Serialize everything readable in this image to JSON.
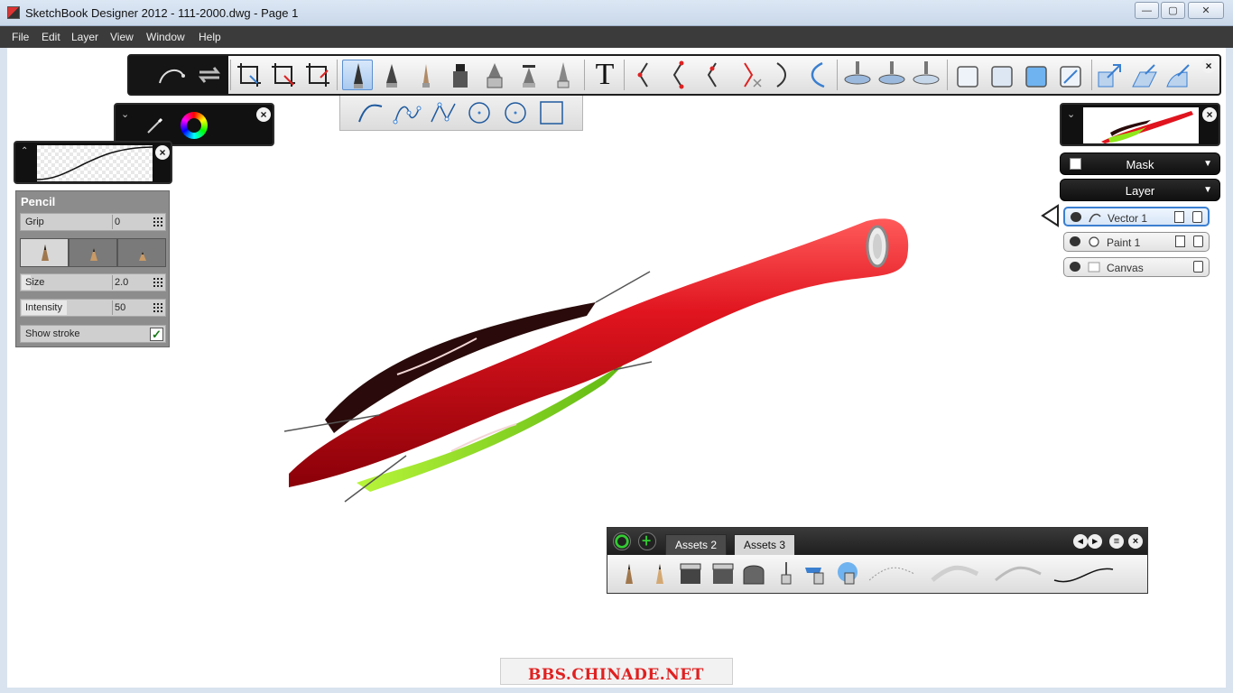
{
  "window": {
    "title": "SketchBook Designer 2012 - 111-2000.dwg - Page 1",
    "minimize_glyph": "—",
    "maximize_glyph": "▢",
    "close_glyph": "✕"
  },
  "menu": [
    "File",
    "Edit",
    "Layer",
    "View",
    "Window",
    "Help"
  ],
  "toolbar": {
    "tools": [
      {
        "name": "lagoon-icon"
      },
      {
        "name": "sync-icon"
      },
      {
        "name": "crop-select-icon"
      },
      {
        "name": "crop-move-icon"
      },
      {
        "name": "crop-rotate-icon"
      },
      {
        "name": "pencil-tool-icon",
        "active": true
      },
      {
        "name": "pen-tool-icon"
      },
      {
        "name": "brush-tool-icon"
      },
      {
        "name": "marker-tool-icon"
      },
      {
        "name": "chisel-tool-icon"
      },
      {
        "name": "airbrush-tool-icon"
      },
      {
        "name": "ink-pen-tool-icon"
      },
      {
        "name": "text-tool-icon"
      },
      {
        "name": "edit-curve-icon"
      },
      {
        "name": "edit-point-icon"
      },
      {
        "name": "add-point-icon"
      },
      {
        "name": "cut-curve-icon"
      },
      {
        "name": "stroke-icon"
      },
      {
        "name": "feather-icon"
      },
      {
        "name": "fill-brush-a-icon"
      },
      {
        "name": "fill-brush-b-icon"
      },
      {
        "name": "fill-brush-c-icon"
      },
      {
        "name": "bucket-a-icon"
      },
      {
        "name": "bucket-b-icon"
      },
      {
        "name": "bucket-c-icon"
      },
      {
        "name": "bucket-d-icon"
      },
      {
        "name": "transform-scale-icon"
      },
      {
        "name": "transform-skew-icon"
      },
      {
        "name": "transform-warp-icon"
      }
    ],
    "text_glyph": "T"
  },
  "subtoolbar": [
    "freehand-curve-icon",
    "spline-curve-icon",
    "polyline-icon",
    "circle-icon",
    "ellipse-icon",
    "rectangle-icon"
  ],
  "pencil_panel": {
    "title": "Pencil",
    "grip_label": "Grip",
    "grip_value": "0",
    "size_label": "Size",
    "size_value": "2.0",
    "size_fill": 0.1,
    "intensity_label": "Intensity",
    "intensity_value": "50",
    "intensity_fill": 0.5,
    "show_stroke_label": "Show stroke",
    "show_stroke_checked": "✓"
  },
  "layers": {
    "mask_label": "Mask",
    "layer_label": "Layer",
    "dropdown_arrow": "▼",
    "items": [
      {
        "name": "Vector 1",
        "active": true
      },
      {
        "name": "Paint 1",
        "active": false
      },
      {
        "name": "Canvas",
        "active": false
      }
    ]
  },
  "assets": {
    "tabs": [
      "Assets 2",
      "Assets 3"
    ],
    "active_tab": "Assets 3"
  },
  "watermark": "BBS.CHINADE.NET",
  "colors": {
    "accent_blue": "#3a7fd0",
    "drawing_red": "#e0141e",
    "drawing_green": "#8fe81a",
    "dark_panel": "#111111"
  }
}
